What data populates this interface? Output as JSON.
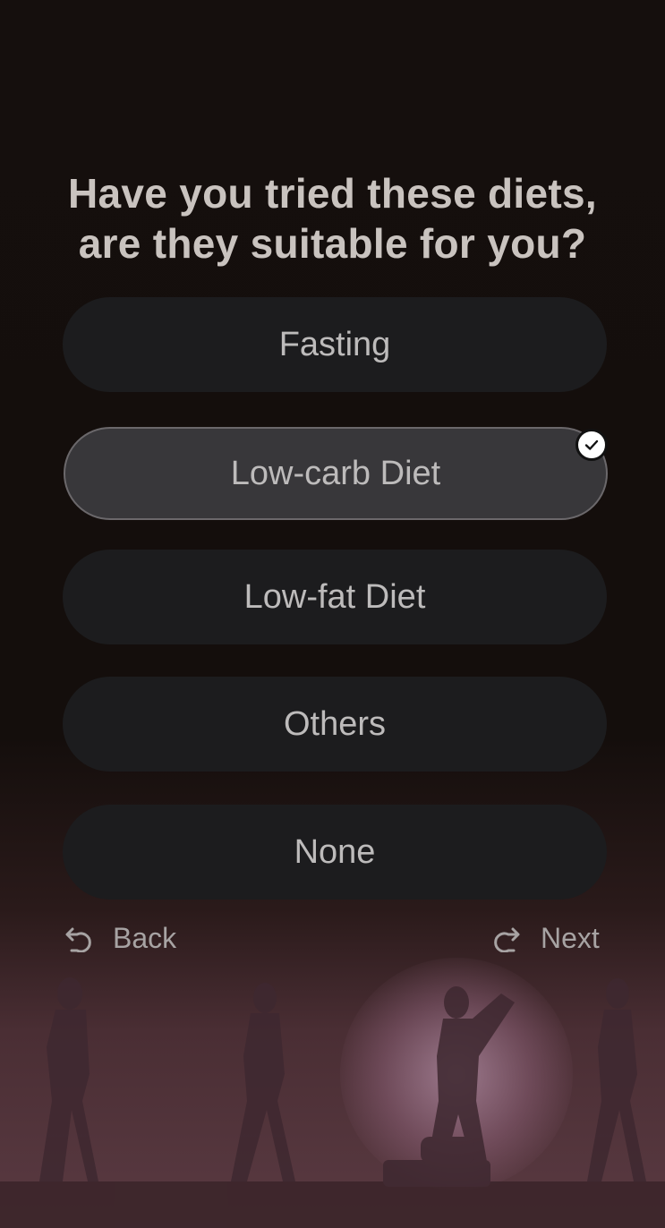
{
  "question": {
    "line1": "Have you tried these diets,",
    "line2": "are they suitable for you?"
  },
  "options": [
    {
      "label": "Fasting",
      "selected": false
    },
    {
      "label": "Low-carb Diet",
      "selected": true
    },
    {
      "label": "Low-fat Diet",
      "selected": false
    },
    {
      "label": "Others",
      "selected": false
    },
    {
      "label": "None",
      "selected": false
    }
  ],
  "nav": {
    "back_label": "Back",
    "next_label": "Next"
  },
  "icons": {
    "check": "check-circle-icon",
    "back": "undo-arrow-icon",
    "next": "redo-arrow-icon"
  },
  "colors": {
    "background": "#140e0c",
    "option_bg": "#1c1c1e",
    "option_selected_bg": "#38373a",
    "text": "#c9c3bf"
  }
}
